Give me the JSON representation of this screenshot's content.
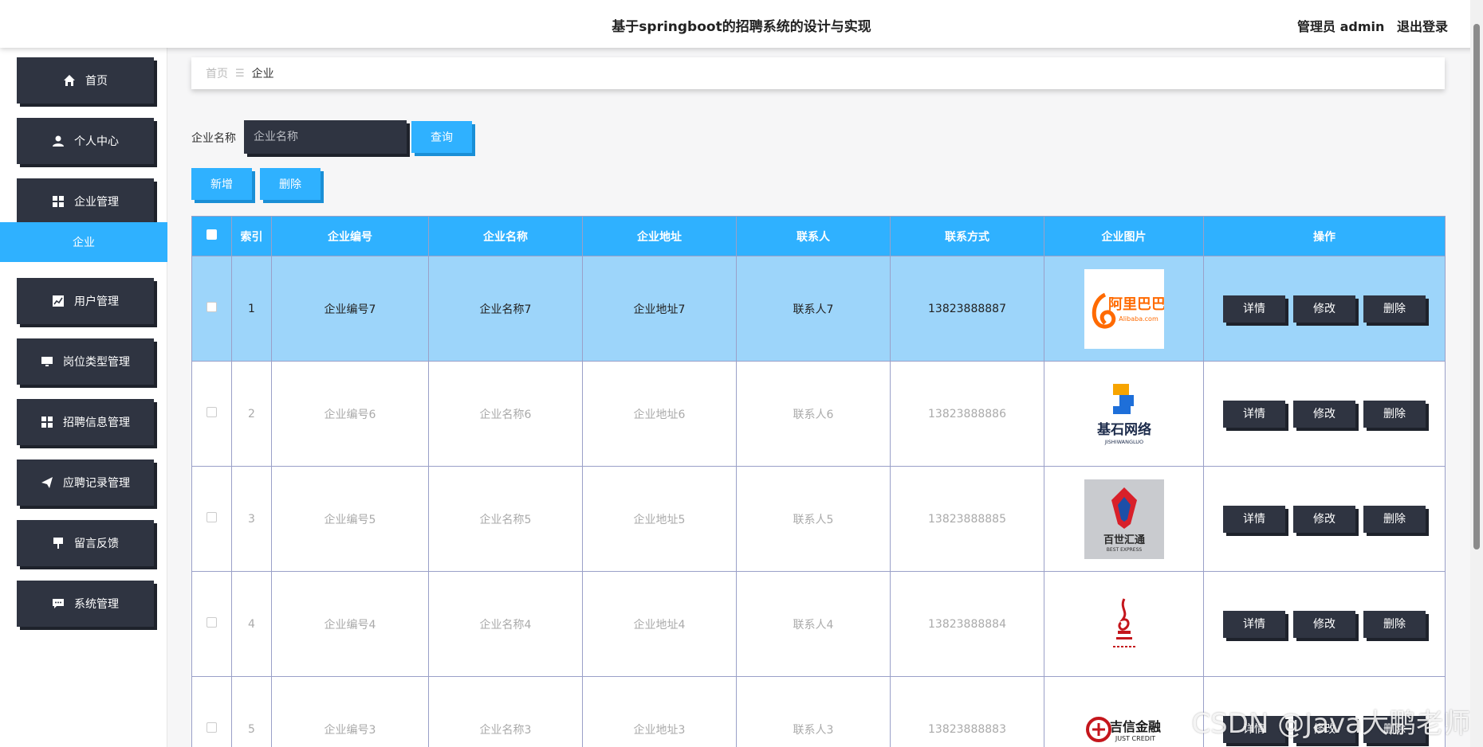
{
  "header": {
    "title": "基于springboot的招聘系统的设计与实现",
    "role": "管理员 admin",
    "logout": "退出登录"
  },
  "sidebar": {
    "items": [
      {
        "label": "首页",
        "icon": "home-icon"
      },
      {
        "label": "个人中心",
        "icon": "user-icon"
      },
      {
        "label": "企业管理",
        "icon": "grid-icon"
      },
      {
        "label": "用户管理",
        "icon": "chart-icon"
      },
      {
        "label": "岗位类型管理",
        "icon": "monitor-icon"
      },
      {
        "label": "招聘信息管理",
        "icon": "grid-icon"
      },
      {
        "label": "应聘记录管理",
        "icon": "send-icon"
      },
      {
        "label": "留言反馈",
        "icon": "sign-icon"
      },
      {
        "label": "系统管理",
        "icon": "chat-icon"
      }
    ],
    "active_sub": "企业"
  },
  "breadcrumb": {
    "home": "首页",
    "separator": "☰",
    "current": "企业"
  },
  "search": {
    "label": "企业名称",
    "placeholder": "企业名称",
    "button": "查询"
  },
  "actions": {
    "add": "新增",
    "delete": "删除"
  },
  "table": {
    "headers": [
      "索引",
      "企业编号",
      "企业名称",
      "企业地址",
      "联系人",
      "联系方式",
      "企业图片",
      "操作"
    ],
    "ops": [
      "详情",
      "修改",
      "删除"
    ],
    "rows": [
      {
        "index": "1",
        "code": "企业编号7",
        "name": "企业名称7",
        "address": "企业地址7",
        "contact": "联系人7",
        "phone": "13823888887",
        "logo": "alibaba-logo",
        "logo_text": "阿里巴巴",
        "logo_sub": "Alibaba.com"
      },
      {
        "index": "2",
        "code": "企业编号6",
        "name": "企业名称6",
        "address": "企业地址6",
        "contact": "联系人6",
        "phone": "13823888886",
        "logo": "jishi-logo",
        "logo_text": "基石网络",
        "logo_sub": "JISHIWANGLUO"
      },
      {
        "index": "3",
        "code": "企业编号5",
        "name": "企业名称5",
        "address": "企业地址5",
        "contact": "联系人5",
        "phone": "13823888885",
        "logo": "best-express-logo",
        "logo_text": "百世汇通",
        "logo_sub": "BEST EXPRESS"
      },
      {
        "index": "4",
        "code": "企业编号4",
        "name": "企业名称4",
        "address": "企业地址4",
        "contact": "联系人4",
        "phone": "13823888884",
        "logo": "red-brush-logo",
        "logo_text": "",
        "logo_sub": ""
      },
      {
        "index": "5",
        "code": "企业编号3",
        "name": "企业名称3",
        "address": "企业地址3",
        "contact": "联系人3",
        "phone": "13823888883",
        "logo": "jixin-logo",
        "logo_text": "吉信金融",
        "logo_sub": "JUST CREDIT"
      }
    ]
  },
  "watermark": "CSDN @Java大鹏老师",
  "colors": {
    "accent": "#2fb1ff",
    "dark": "#2f3441",
    "selected_row": "#9dd5fa"
  }
}
